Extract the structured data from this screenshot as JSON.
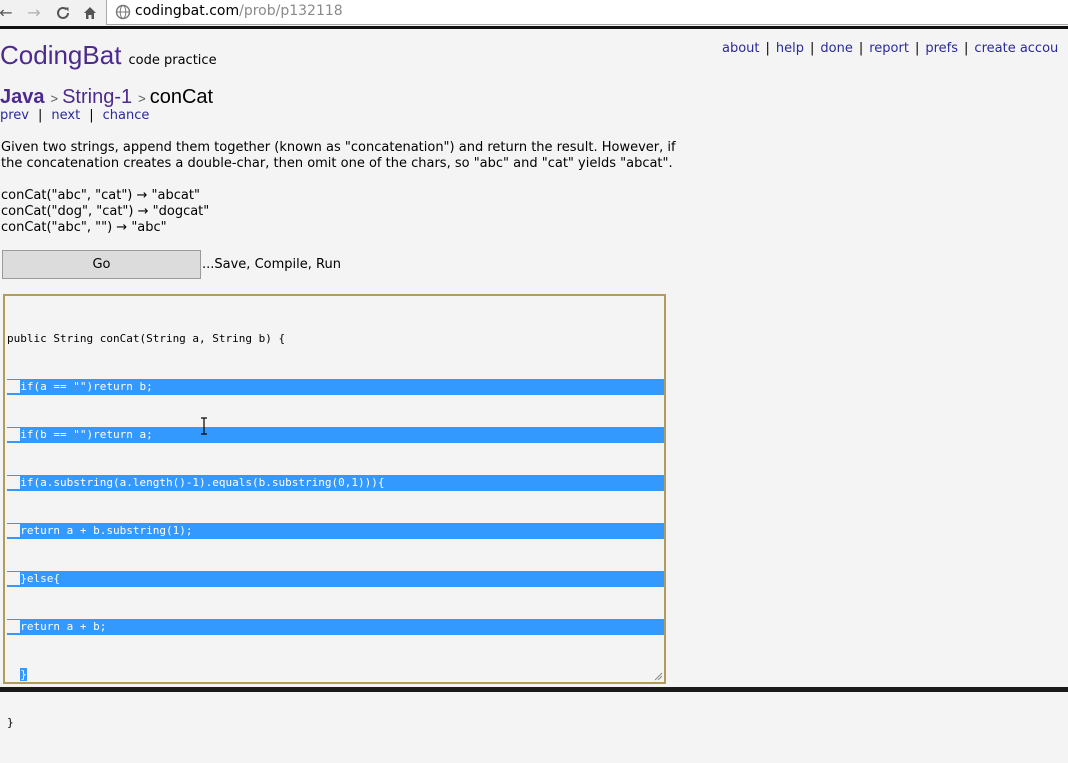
{
  "browser": {
    "url_host": "codingbat.com",
    "url_path": "/prob/p132118"
  },
  "brand": {
    "name": "CodingBat",
    "tagline": "code practice"
  },
  "topnav": {
    "items": [
      "about",
      "help",
      "done",
      "report",
      "prefs",
      "create accou"
    ],
    "separator": "|"
  },
  "breadcrumb": {
    "language": "Java",
    "section": "String-1",
    "problem": "conCat",
    "separator": ">"
  },
  "problem_nav": {
    "prev": "prev",
    "next": "next",
    "chance": "chance",
    "separator": "|"
  },
  "description": "Given two strings, append them together (known as \"concatenation\") and return the result. However, if the concatenation creates a double-char, then omit one of the chars, so \"abc\" and \"cat\" yields \"abcat\".",
  "examples": [
    "conCat(\"abc\", \"cat\") → \"abcat\"",
    "conCat(\"dog\", \"cat\") → \"dogcat\"",
    "conCat(\"abc\", \"\") → \"abc\""
  ],
  "run": {
    "go_label": "Go",
    "hint": "...Save, Compile, Run"
  },
  "editor": {
    "lines": [
      "public String conCat(String a, String b) {",
      "  if(a == \"\")return b;",
      "  if(b == \"\")return a;",
      "  if(a.substring(a.length()-1).equals(b.substring(0,1))){",
      "  return a + b.substring(1);",
      "  }else{",
      "  return a + b;",
      "  }",
      "}"
    ],
    "selection_color": "#3399ff",
    "border_color": "#b39c5a"
  },
  "colors": {
    "brand": "#4c2a8f",
    "link": "#2a2a9c",
    "background": "#f4f4f4"
  }
}
